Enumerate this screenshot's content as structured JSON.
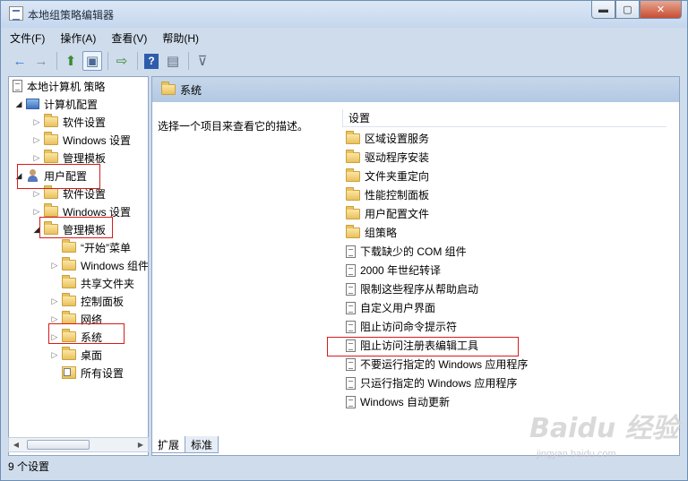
{
  "window": {
    "title": "本地组策略编辑器",
    "min_glyph": "▬",
    "max_glyph": "▢",
    "close_glyph": "✕"
  },
  "menu": [
    {
      "label": "文件(F)"
    },
    {
      "label": "操作(A)"
    },
    {
      "label": "查看(V)"
    },
    {
      "label": "帮助(H)"
    }
  ],
  "toolbar": {
    "back_icon": "←",
    "forward_icon": "→",
    "up_icon": "⬆",
    "show_tree_icon": "▣",
    "export_icon": "⇨",
    "help_icon": "?",
    "properties_icon": "▤",
    "filter_icon": "⊽"
  },
  "tree": {
    "root": "本地计算机 策略",
    "computer_config": "计算机配置",
    "c_software": "软件设置",
    "c_windows": "Windows 设置",
    "c_admin": "管理模板",
    "user_config": "用户配置",
    "u_software": "软件设置",
    "u_windows": "Windows 设置",
    "u_admin": "管理模板",
    "start_menu": "“开始”菜单",
    "windows_comp": "Windows 组件",
    "shared_folders": "共享文件夹",
    "control_panel": "控制面板",
    "network": "网络",
    "system": "系统",
    "desktop": "桌面",
    "all_settings": "所有设置"
  },
  "content": {
    "header_title": "系统",
    "description": "选择一个项目来查看它的描述。",
    "column_header": "设置",
    "items": [
      {
        "label": "区域设置服务",
        "type": "folder"
      },
      {
        "label": "驱动程序安装",
        "type": "folder"
      },
      {
        "label": "文件夹重定向",
        "type": "folder"
      },
      {
        "label": "性能控制面板",
        "type": "folder"
      },
      {
        "label": "用户配置文件",
        "type": "folder"
      },
      {
        "label": "组策略",
        "type": "folder"
      },
      {
        "label": "下载缺少的 COM 组件",
        "type": "setting"
      },
      {
        "label": "2000 年世纪转译",
        "type": "setting"
      },
      {
        "label": "限制这些程序从帮助启动",
        "type": "setting"
      },
      {
        "label": "自定义用户界面",
        "type": "setting"
      },
      {
        "label": "阻止访问命令提示符",
        "type": "setting"
      },
      {
        "label": "阻止访问注册表编辑工具",
        "type": "setting"
      },
      {
        "label": "不要运行指定的 Windows 应用程序",
        "type": "setting"
      },
      {
        "label": "只运行指定的 Windows 应用程序",
        "type": "setting"
      },
      {
        "label": "Windows 自动更新",
        "type": "setting"
      }
    ]
  },
  "tabs": [
    {
      "label": "扩展"
    },
    {
      "label": "标准"
    }
  ],
  "status": "9 个设置",
  "watermark": {
    "main": "Baidu 经验",
    "sub": "jingyan.baidu.com"
  },
  "colors": {
    "highlight": "#d91a1a",
    "header_bg": "#b1c8e3"
  }
}
